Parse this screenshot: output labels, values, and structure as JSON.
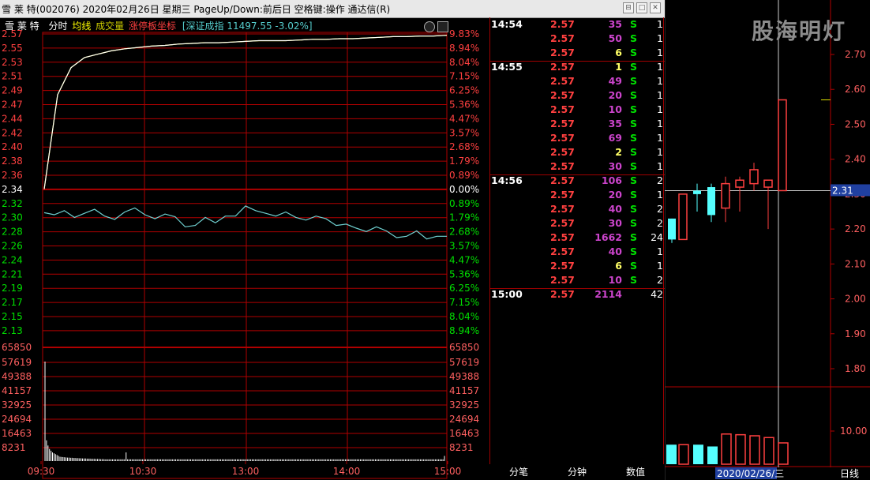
{
  "titlebar": {
    "text": "雪 莱 特(002076)  2020年02月26日 星期三  PageUp/Down:前后日 空格键:操作 通达信(R)"
  },
  "chart_header": {
    "name": "雪 莱 特",
    "tabs": [
      "分时",
      "均线",
      "成交量",
      "涨停板坐标"
    ],
    "index_text": "[深证成指 11497.55 -3.02%]"
  },
  "colors": {
    "up": "#ff4040",
    "down": "#00e000",
    "grid": "#b00000",
    "price_line": "#ffffff",
    "avg_line": "#ffff00",
    "index_line": "#6fd0d0",
    "volume": "#ffffff",
    "purple": "#cc44cc",
    "cyan": "#55ffff"
  },
  "price_axis": {
    "left": [
      "2.57",
      "2.55",
      "2.53",
      "2.51",
      "2.49",
      "2.47",
      "2.44",
      "2.42",
      "2.40",
      "2.38",
      "2.36",
      "2.34",
      "2.32",
      "2.30",
      "2.28",
      "2.26",
      "2.24",
      "2.21",
      "2.19",
      "2.17",
      "2.15",
      "2.13"
    ],
    "right": [
      "9.83%",
      "8.94%",
      "8.04%",
      "7.15%",
      "6.25%",
      "5.36%",
      "4.47%",
      "3.57%",
      "2.68%",
      "1.79%",
      "0.89%",
      "0.00%",
      "0.89%",
      "1.79%",
      "2.68%",
      "3.57%",
      "4.47%",
      "5.36%",
      "6.25%",
      "7.15%",
      "8.04%",
      "8.94%"
    ],
    "base_index": 11
  },
  "volume_axis": {
    "labels": [
      "65850",
      "57619",
      "49388",
      "41157",
      "32925",
      "24694",
      "16463",
      "8231"
    ]
  },
  "time_axis": [
    "09:30",
    "10:30",
    "13:00",
    "14:00",
    "15:00"
  ],
  "chart_data": {
    "type": "line",
    "date": "2020年02月26日",
    "price_ylim": [
      2.11,
      2.57
    ],
    "volume_ylim": [
      0,
      65850
    ],
    "series": [
      {
        "name": "分时",
        "values": [
          2.34,
          2.48,
          2.52,
          2.535,
          2.54,
          2.545,
          2.548,
          2.55,
          2.552,
          2.553,
          2.555,
          2.556,
          2.557,
          2.557,
          2.558,
          2.559,
          2.56,
          2.56,
          2.56,
          2.561,
          2.562,
          2.562,
          2.563,
          2.563,
          2.564,
          2.565,
          2.566,
          2.566,
          2.567,
          2.567,
          2.568
        ]
      },
      {
        "name": "均线",
        "values": [
          2.34,
          2.48,
          2.52,
          2.535,
          2.54,
          2.545,
          2.548,
          2.55,
          2.552,
          2.553,
          2.555,
          2.556,
          2.557,
          2.557,
          2.558,
          2.559,
          2.56,
          2.56,
          2.56,
          2.561,
          2.562,
          2.562,
          2.563,
          2.563,
          2.564,
          2.565,
          2.566,
          2.566,
          2.567,
          2.567,
          2.568
        ]
      },
      {
        "name": "深证成指",
        "values": [
          2.305,
          2.302,
          2.308,
          2.298,
          2.304,
          2.31,
          2.3,
          2.295,
          2.306,
          2.312,
          2.302,
          2.296,
          2.303,
          2.299,
          2.284,
          2.286,
          2.298,
          2.29,
          2.3,
          2.3,
          2.315,
          2.308,
          2.304,
          2.3,
          2.306,
          2.298,
          2.294,
          2.3,
          2.296,
          2.286,
          2.288,
          2.282,
          2.277,
          2.284,
          2.278,
          2.268,
          2.27,
          2.278,
          2.266,
          2.27,
          2.27
        ]
      },
      {
        "name": "成交量",
        "values": [
          57619,
          12000,
          9000,
          7000,
          6000,
          5000,
          4500,
          4000,
          3500,
          3000,
          2500,
          2400,
          2300,
          2200,
          2100,
          2000,
          2000,
          1900,
          1900,
          1800,
          1800,
          1700,
          1700,
          1600,
          1600,
          1500,
          1500,
          1500,
          1400,
          1400,
          1400,
          1300,
          1300,
          1300,
          1200,
          1200,
          1200,
          1100,
          1100,
          1100,
          1000,
          1000,
          1000,
          1000,
          1000,
          1000,
          1000,
          1000,
          1000,
          1000,
          1000,
          1000,
          1000,
          1000,
          5000,
          1000,
          1000,
          1000,
          1000,
          1000,
          1000,
          1000,
          1000,
          1000,
          1000,
          1000,
          1000,
          1000,
          1000,
          1000,
          1000,
          1000,
          1000,
          1000,
          1000,
          1000,
          1000,
          1000,
          1000,
          1000,
          1000,
          1000,
          1000,
          1000,
          1000,
          1000,
          1000,
          1000,
          1000,
          1000,
          1000,
          1000,
          1000,
          1000,
          1000,
          1000,
          1000,
          1000,
          1000,
          1000,
          1000,
          1000,
          1000,
          1000,
          1000,
          1000,
          1000,
          1000,
          1000,
          1000,
          1000,
          1000,
          1000,
          1000,
          1000,
          1000,
          1000,
          1000,
          1000,
          1000,
          1000,
          1000,
          1000,
          1000,
          1000,
          1000,
          1000,
          1000,
          1000,
          1000,
          1000,
          1000,
          1000,
          1000,
          1000,
          1000,
          1000,
          1000,
          1000,
          1000,
          1000,
          1000,
          1000,
          1000,
          1000,
          1000,
          1000,
          1000,
          1000,
          1000,
          1000,
          1000,
          1000,
          1000,
          1000,
          1000,
          1000,
          1000,
          1000,
          1000,
          1000,
          1000,
          1000,
          1000,
          1000,
          1000,
          1000,
          1000,
          1000,
          1000,
          1000,
          1000,
          1000,
          1000,
          1000,
          1000,
          1000,
          1000,
          1000,
          1000,
          1000,
          1000,
          1000,
          1000,
          1000,
          1000,
          1000,
          1000,
          1000,
          1000,
          1000,
          1000,
          1000,
          1000,
          1000,
          1000,
          1000,
          1000,
          1000,
          1000,
          1000,
          1000,
          1000,
          1000,
          1000,
          1000,
          1000,
          1000,
          1000,
          1000,
          1000,
          1000,
          1000,
          1000,
          1000,
          1000,
          1000,
          1000,
          1000,
          1000,
          1000,
          1000,
          1000,
          1000,
          1000,
          1000,
          1000,
          1000,
          1000,
          1000,
          1000,
          1000,
          1000,
          1000,
          1000,
          1000,
          1000,
          1000,
          1000,
          1000,
          1000,
          1000,
          1000,
          1000,
          1000,
          1000,
          1000,
          1000,
          1000,
          1000,
          1000,
          1000,
          1000,
          1000,
          1000,
          1000,
          1000,
          1000,
          1000,
          1000,
          1000,
          1000,
          1000,
          1000,
          1000,
          1000,
          3000
        ]
      }
    ]
  },
  "trades": [
    {
      "time": "14:54",
      "price": "2.57",
      "vol": "35",
      "side": "S",
      "count": "1"
    },
    {
      "time": "",
      "price": "2.57",
      "vol": "50",
      "side": "S",
      "count": "1"
    },
    {
      "time": "",
      "price": "2.57",
      "vol": "6",
      "side": "S",
      "count": "1"
    },
    {
      "time": "14:55",
      "price": "2.57",
      "vol": "1",
      "side": "S",
      "count": "1"
    },
    {
      "time": "",
      "price": "2.57",
      "vol": "49",
      "side": "S",
      "count": "1"
    },
    {
      "time": "",
      "price": "2.57",
      "vol": "20",
      "side": "S",
      "count": "1"
    },
    {
      "time": "",
      "price": "2.57",
      "vol": "10",
      "side": "S",
      "count": "1"
    },
    {
      "time": "",
      "price": "2.57",
      "vol": "35",
      "side": "S",
      "count": "1"
    },
    {
      "time": "",
      "price": "2.57",
      "vol": "69",
      "side": "S",
      "count": "1"
    },
    {
      "time": "",
      "price": "2.57",
      "vol": "2",
      "side": "S",
      "count": "1"
    },
    {
      "time": "",
      "price": "2.57",
      "vol": "30",
      "side": "S",
      "count": "1"
    },
    {
      "time": "14:56",
      "price": "2.57",
      "vol": "106",
      "side": "S",
      "count": "2"
    },
    {
      "time": "",
      "price": "2.57",
      "vol": "20",
      "side": "S",
      "count": "1"
    },
    {
      "time": "",
      "price": "2.57",
      "vol": "40",
      "side": "S",
      "count": "2"
    },
    {
      "time": "",
      "price": "2.57",
      "vol": "30",
      "side": "S",
      "count": "2"
    },
    {
      "time": "",
      "price": "2.57",
      "vol": "1662",
      "side": "S",
      "count": "24"
    },
    {
      "time": "",
      "price": "2.57",
      "vol": "40",
      "side": "S",
      "count": "1"
    },
    {
      "time": "",
      "price": "2.57",
      "vol": "6",
      "side": "S",
      "count": "1"
    },
    {
      "time": "",
      "price": "2.57",
      "vol": "10",
      "side": "S",
      "count": "2"
    },
    {
      "time": "15:00",
      "price": "2.57",
      "vol": "2114",
      "side": "",
      "count": "42"
    }
  ],
  "bottom_tabs": [
    "分笔",
    "分钟",
    "数值"
  ],
  "kline": {
    "watermark": "股海明灯",
    "price_labels": [
      "2.70",
      "2.60",
      "2.50",
      "2.40",
      "2.31",
      "2.30",
      "2.20",
      "2.10",
      "2.00",
      "1.90",
      "1.80"
    ],
    "current_price_tag": "2.31",
    "volume_label": "10.00",
    "date_label": "2020/02/26/三",
    "period_label": "日线",
    "candles": [
      {
        "o": 2.17,
        "c": 2.23,
        "h": 2.23,
        "l": 2.16,
        "up": false
      },
      {
        "o": 2.17,
        "c": 2.3,
        "h": 2.3,
        "l": 2.17,
        "up": true
      },
      {
        "o": 2.31,
        "c": 2.3,
        "h": 2.33,
        "l": 2.25,
        "up": false
      },
      {
        "o": 2.24,
        "c": 2.32,
        "h": 2.33,
        "l": 2.22,
        "up": false
      },
      {
        "o": 2.26,
        "c": 2.33,
        "h": 2.35,
        "l": 2.22,
        "up": true
      },
      {
        "o": 2.32,
        "c": 2.34,
        "h": 2.35,
        "l": 2.25,
        "up": true
      },
      {
        "o": 2.33,
        "c": 2.37,
        "h": 2.39,
        "l": 2.31,
        "up": true
      },
      {
        "o": 2.32,
        "c": 2.34,
        "h": 2.34,
        "l": 2.2,
        "up": true
      },
      {
        "o": 2.31,
        "c": 2.57,
        "h": 2.57,
        "l": 2.31,
        "up": true
      }
    ],
    "volumes": [
      0.55,
      0.55,
      0.55,
      0.5,
      0.85,
      0.83,
      0.8,
      0.75,
      0.6
    ]
  }
}
